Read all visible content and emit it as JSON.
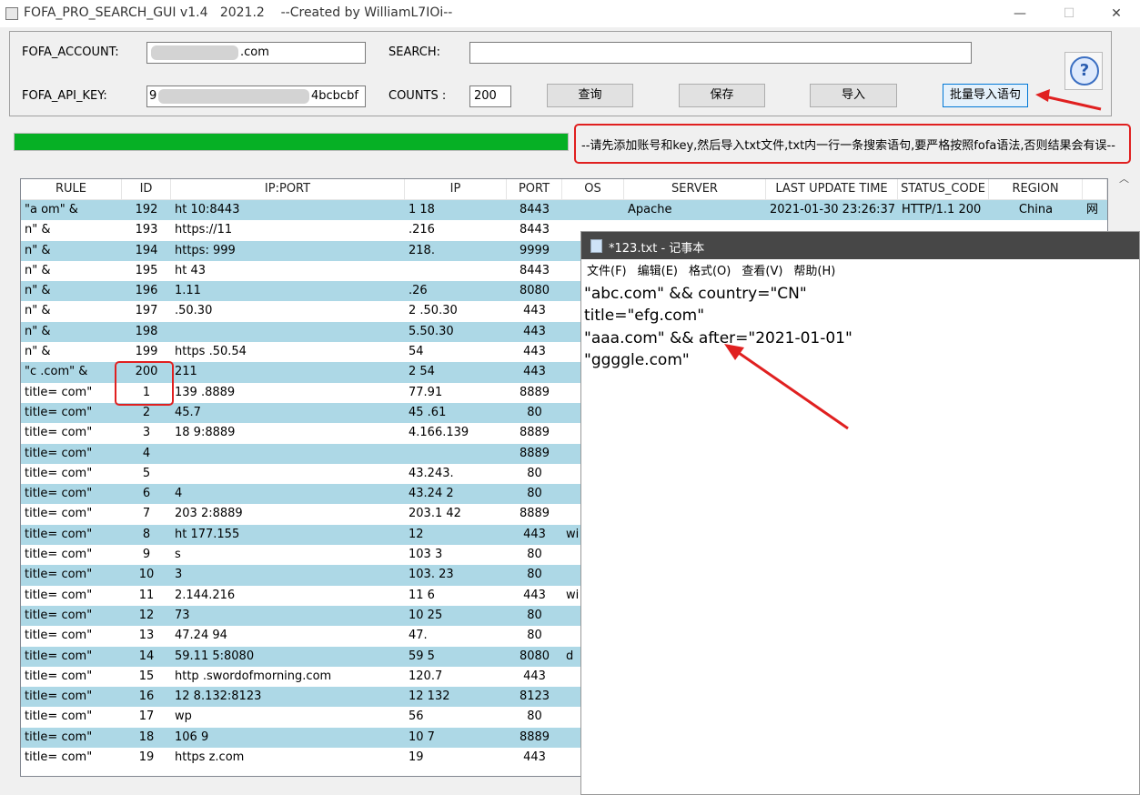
{
  "window": {
    "title": "FOFA_PRO_SEARCH_GUI v1.4   2021.2    --Created by WilliamL7IOi--",
    "minimize": "—",
    "maximize": "☐",
    "close": "✕"
  },
  "form": {
    "account_label": "FOFA_ACCOUNT:",
    "account_value": ".com",
    "api_key_label": "FOFA_API_KEY:",
    "api_key_prefix": "9",
    "api_key_value": "4bcbcbf",
    "search_label": "SEARCH:",
    "search_value": "",
    "counts_label": "COUNTS :",
    "counts_value": "200",
    "query_button": "查询",
    "save_button": "保存",
    "import_button": "导入",
    "batch_import_button": "批量导入语句",
    "help_icon": "?"
  },
  "progress": {
    "fraction": 1.0
  },
  "notice": "--请先添加账号和key,然后导入txt文件,txt内一行一条搜索语句,要严格按照fofa语法,否则结果会有误--",
  "table": {
    "headers": [
      "RULE",
      "ID",
      "IP:PORT",
      "IP",
      "PORT",
      "OS",
      "SERVER",
      "LAST UPDATE TIME",
      "STATUS_CODE",
      "REGION"
    ],
    "rows": [
      {
        "rule": "\"a         om\" &",
        "id": "192",
        "ipport": "ht              10:8443",
        "ip": "1      18",
        "port": "8443",
        "os": "",
        "server": "Apache",
        "time": "2021-01-30 23:26:37",
        "status": "HTTP/1.1 200",
        "region": "China",
        "extra": "网"
      },
      {
        "rule": "           n\" &",
        "id": "193",
        "ipport": "https://11          ",
        "ip": "         .216",
        "port": "8443",
        "os": "",
        "server": "",
        "time": "",
        "status": "",
        "region": "",
        "extra": ""
      },
      {
        "rule": "           n\" &",
        "id": "194",
        "ipport": "https:              999",
        "ip": "218.          ",
        "port": "9999",
        "os": "",
        "server": "",
        "time": "",
        "status": "",
        "region": "",
        "extra": ""
      },
      {
        "rule": "           n\" &",
        "id": "195",
        "ipport": "ht                  43",
        "ip": "             ",
        "port": "8443",
        "os": "",
        "server": "",
        "time": "",
        "status": "",
        "region": "",
        "extra": ""
      },
      {
        "rule": "           n\" &",
        "id": "196",
        "ipport": "1.11            ",
        "ip": "           .26",
        "port": "8080",
        "os": "",
        "server": "",
        "time": "",
        "status": "",
        "region": "",
        "extra": ""
      },
      {
        "rule": "           n\" &",
        "id": "197",
        "ipport": "              .50.30",
        "ip": "2        .50.30",
        "port": "443",
        "os": "",
        "server": "",
        "time": "",
        "status": "",
        "region": "",
        "extra": ""
      },
      {
        "rule": "           n\" &",
        "id": "198",
        "ipport": "                ",
        "ip": "        5.50.30",
        "port": "443",
        "os": "",
        "server": "",
        "time": "",
        "status": "",
        "region": "",
        "extra": ""
      },
      {
        "rule": "           n\" &",
        "id": "199",
        "ipport": "https          .50.54",
        "ip": "            54",
        "port": "443",
        "os": "",
        "server": "",
        "time": "",
        "status": "",
        "region": "",
        "extra": ""
      },
      {
        "rule": "\"c       .com\" &",
        "id": "200",
        "ipport": "211             ",
        "ip": "2          54",
        "port": "443",
        "os": "",
        "server": "",
        "time": "",
        "status": "",
        "region": "",
        "extra": ""
      },
      {
        "rule": "title=       com\"",
        "id": "1",
        "ipport": "139            .8889",
        "ip": "           77.91",
        "port": "8889",
        "os": "",
        "server": "",
        "time": "",
        "status": "",
        "region": "",
        "extra": ""
      },
      {
        "rule": "title=       com\"",
        "id": "2",
        "ipport": "45.7           ",
        "ip": "45        .61",
        "port": "80",
        "os": "",
        "server": "",
        "time": "",
        "status": "",
        "region": "",
        "extra": ""
      },
      {
        "rule": "title=       com\"",
        "id": "3",
        "ipport": "18              9:8889",
        "ip": "        4.166.139",
        "port": "8889",
        "os": "",
        "server": "",
        "time": "",
        "status": "",
        "region": "",
        "extra": ""
      },
      {
        "rule": "title=       com\"",
        "id": "4",
        "ipport": "                ",
        "ip": "             ",
        "port": "8889",
        "os": "",
        "server": "",
        "time": "",
        "status": "",
        "region": "",
        "extra": ""
      },
      {
        "rule": "title=       com\"",
        "id": "5",
        "ipport": "                ",
        "ip": "43.243.        ",
        "port": "80",
        "os": "",
        "server": "",
        "time": "",
        "status": "",
        "region": "",
        "extra": ""
      },
      {
        "rule": "title=       com\"",
        "id": "6",
        "ipport": "4               ",
        "ip": "43.24         2",
        "port": "80",
        "os": "",
        "server": "",
        "time": "",
        "status": "",
        "region": "",
        "extra": ""
      },
      {
        "rule": "title=       com\"",
        "id": "7",
        "ipport": "203           2:8889",
        "ip": "203.1        42",
        "port": "8889",
        "os": "",
        "server": "",
        "time": "",
        "status": "",
        "region": "",
        "extra": ""
      },
      {
        "rule": "title=       com\"",
        "id": "8",
        "ipport": "ht            177.155",
        "ip": "12             ",
        "port": "443",
        "os": "wi",
        "server": "",
        "time": "",
        "status": "",
        "region": "",
        "extra": ""
      },
      {
        "rule": "title=       com\"",
        "id": "9",
        "ipport": "s               ",
        "ip": "103           3",
        "port": "80",
        "os": "",
        "server": "",
        "time": "",
        "status": "",
        "region": "",
        "extra": ""
      },
      {
        "rule": "title=       com\"",
        "id": "10",
        "ipport": "              3",
        "ip": "103.         23",
        "port": "80",
        "os": "",
        "server": "",
        "time": "",
        "status": "",
        "region": "",
        "extra": ""
      },
      {
        "rule": "title=       com\"",
        "id": "11",
        "ipport": "              2.144.216",
        "ip": "11          6",
        "port": "443",
        "os": "wi",
        "server": "",
        "time": "",
        "status": "",
        "region": "",
        "extra": ""
      },
      {
        "rule": "title=       com\"",
        "id": "12",
        "ipport": "73            ",
        "ip": "10          25",
        "port": "80",
        "os": "",
        "server": "",
        "time": "",
        "status": "",
        "region": "",
        "extra": ""
      },
      {
        "rule": "title=       com\"",
        "id": "13",
        "ipport": "47.24          94",
        "ip": "47.           ",
        "port": "80",
        "os": "",
        "server": "",
        "time": "",
        "status": "",
        "region": "",
        "extra": ""
      },
      {
        "rule": "title=       com\"",
        "id": "14",
        "ipport": "59.11           5:8080",
        "ip": "59            5",
        "port": "8080",
        "os": "d",
        "server": "",
        "time": "",
        "status": "",
        "region": "",
        "extra": ""
      },
      {
        "rule": "title=       com\"",
        "id": "15",
        "ipport": "http          .swordofmorning.com",
        "ip": "120.7          ",
        "port": "443",
        "os": "",
        "server": "",
        "time": "",
        "status": "",
        "region": "",
        "extra": ""
      },
      {
        "rule": "title=       com\"",
        "id": "16",
        "ipport": "12            8.132:8123",
        "ip": "12          132",
        "port": "8123",
        "os": "",
        "server": "",
        "time": "",
        "status": "",
        "region": "",
        "extra": ""
      },
      {
        "rule": "title=       com\"",
        "id": "17",
        "ipport": "wp             ",
        "ip": "             56",
        "port": "80",
        "os": "",
        "server": "",
        "time": "",
        "status": "",
        "region": "",
        "extra": ""
      },
      {
        "rule": "title=       com\"",
        "id": "18",
        "ipport": "106            9",
        "ip": "10           7",
        "port": "8889",
        "os": "",
        "server": "",
        "time": "",
        "status": "",
        "region": "",
        "extra": ""
      },
      {
        "rule": "title=       com\"",
        "id": "19",
        "ipport": "https          z.com",
        "ip": "19            ",
        "port": "443",
        "os": "",
        "server": "",
        "time": "",
        "status": "",
        "region": "",
        "extra": ""
      }
    ]
  },
  "notepad": {
    "title": "*123.txt - 记事本",
    "menu": [
      "文件(F)",
      "编辑(E)",
      "格式(O)",
      "查看(V)",
      "帮助(H)"
    ],
    "lines": [
      "\"abc.com\" && country=\"CN\"",
      "title=\"efg.com\"",
      "\"aaa.com\" && after=\"2021-01-01\"",
      "\"ggggle.com\""
    ]
  },
  "colors": {
    "progress": "#06b025",
    "row_alt": "#add8e6",
    "annotation": "#e02020",
    "notepad_titlebar": "#474747"
  }
}
